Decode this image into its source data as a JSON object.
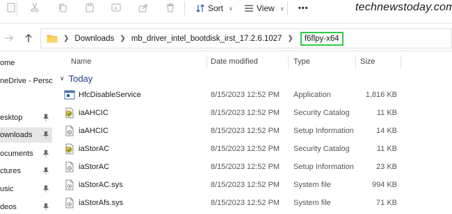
{
  "toolbar": {
    "sort_label": "Sort",
    "view_label": "View",
    "more_label": "•••"
  },
  "watermark": "technewstoday.com",
  "address": {
    "crumbs": [
      "Downloads",
      "mb_driver_intel_bootdisk_irst_17.2.6.1027"
    ],
    "current": "f6flpy-x64"
  },
  "sidebar": {
    "items": [
      {
        "label": "ome"
      },
      {
        "label": "neDrive - Persona"
      },
      {
        "label": "esktop"
      },
      {
        "label": "ownloads"
      },
      {
        "label": "ocuments"
      },
      {
        "label": "ctures"
      },
      {
        "label": "usic"
      },
      {
        "label": "deos"
      }
    ]
  },
  "columns": {
    "name": "Name",
    "date": "Date modified",
    "type": "Type",
    "size": "Size"
  },
  "group": {
    "label": "Today"
  },
  "files": [
    {
      "name": "HfcDisableService",
      "date": "8/15/2023 12:52 PM",
      "type": "Application",
      "size": "1,816 KB",
      "icon": "application-icon"
    },
    {
      "name": "iaAHCIC",
      "date": "8/15/2023 12:52 PM",
      "type": "Security Catalog",
      "size": "11 KB",
      "icon": "security-catalog-icon"
    },
    {
      "name": "iaAHCIC",
      "date": "8/15/2023 12:52 PM",
      "type": "Setup Information",
      "size": "14 KB",
      "icon": "setup-information-icon"
    },
    {
      "name": "iaStorAC",
      "date": "8/15/2023 12:52 PM",
      "type": "Security Catalog",
      "size": "11 KB",
      "icon": "security-catalog-icon"
    },
    {
      "name": "iaStorAC",
      "date": "8/15/2023 12:52 PM",
      "type": "Setup Information",
      "size": "23 KB",
      "icon": "setup-information-icon"
    },
    {
      "name": "iaStorAC.sys",
      "date": "8/15/2023 12:52 PM",
      "type": "System file",
      "size": "994 KB",
      "icon": "system-file-icon"
    },
    {
      "name": "iaStorAfs.sys",
      "date": "8/15/2023 12:52 PM",
      "type": "System file",
      "size": "71 KB",
      "icon": "system-file-icon"
    }
  ]
}
